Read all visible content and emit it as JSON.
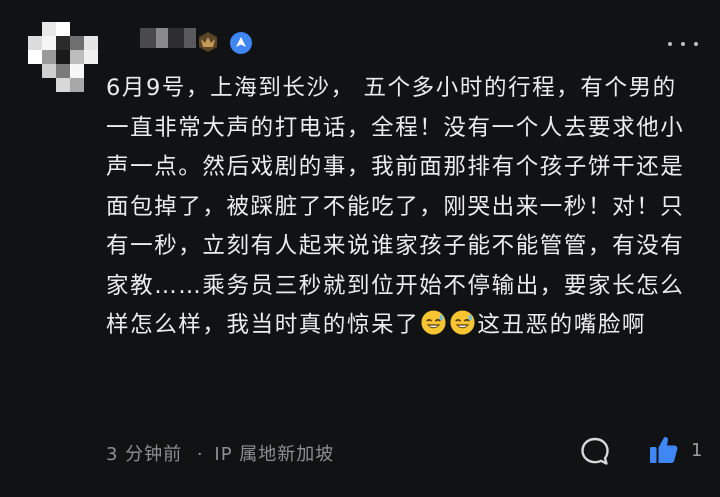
{
  "user": {
    "avatar_icon": "pixelated-avatar",
    "name_hidden": true,
    "badge_icon": "level-badge-icon",
    "verify_icon": "verified-icon",
    "badge_color": "#b7925a",
    "verify_color": "#3f86f7"
  },
  "menu": {
    "icon": "more-options-icon"
  },
  "comment": {
    "text_before_emojis": "6月9号，上海到长沙，  五个多小时的行程，有个男的一直非常大声的打电话，全程！没有一个人去要求他小声一点。然后戏剧的事，我前面那排有个孩子饼干还是面包掉了，被踩脏了不能吃了，刚哭出来一秒！对！只有一秒，立刻有人起来说谁家孩子能不能管管，有没有家教……乘务员三秒就到位开始不停输出，要家长怎么样怎么样，我当时真的惊呆了",
    "emojis": [
      "sweat-smile-emoji",
      "sweat-smile-emoji"
    ],
    "text_after_emojis": "这丑恶的嘴脸啊"
  },
  "footer": {
    "time": "3 分钟前",
    "separator": "·",
    "location": "IP 属地新加坡",
    "reply_icon": "comment-icon",
    "like_icon": "thumbs-up-icon",
    "like_count": "1",
    "like_color": "#3f86f7"
  }
}
